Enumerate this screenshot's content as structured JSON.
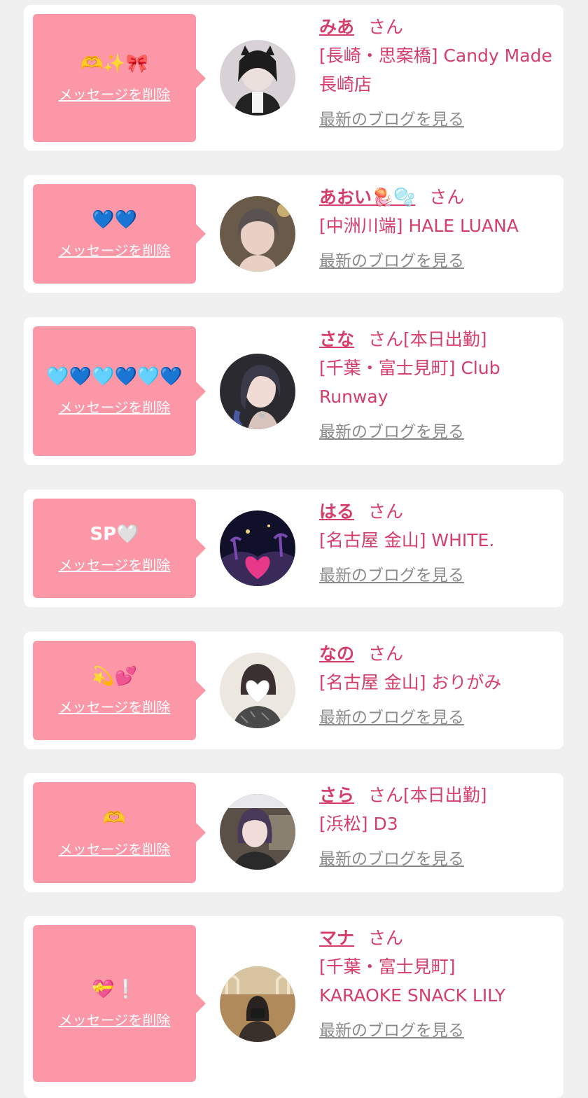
{
  "colors": {
    "accent": "#d63e6a",
    "bubble": "#fc97a8",
    "background": "#f0f0f0"
  },
  "common": {
    "delete_label": "メッセージを削除",
    "honorific": "さん",
    "blog_label": "最新のブログを見る"
  },
  "items": [
    {
      "message": "🫶✨🎀",
      "name": "みあ",
      "status": "",
      "shop": "[長崎・思案橋] Candy Made 長崎店"
    },
    {
      "message": "💙💙",
      "name": "あおい🪼🫧",
      "status": "",
      "shop": "[中洲川端] HALE LUANA"
    },
    {
      "message": "🩵💙🩵💙🩵💙",
      "name": "さな",
      "status": "[本日出勤]",
      "shop": "[千葉・富士見町] Club Runway"
    },
    {
      "message": "SP🤍",
      "name": "はる",
      "status": "",
      "shop": "[名古屋 金山] WHITE."
    },
    {
      "message": "💫💕",
      "name": "なの",
      "status": "",
      "shop": "[名古屋 金山] おりがみ"
    },
    {
      "message": "🫶",
      "name": "さら",
      "status": "[本日出勤]",
      "shop": "[浜松] D3"
    },
    {
      "message": "💝❕",
      "name": "マナ",
      "status": "",
      "shop": "[千葉・富士見町] KARAOKE SNACK LILY"
    }
  ]
}
